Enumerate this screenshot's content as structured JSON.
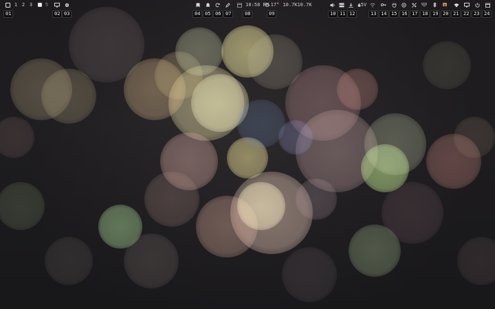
{
  "topbar": {
    "workspaces": [
      "1",
      "2",
      "3",
      "5"
    ],
    "clock": "10:58 PM",
    "weather": "17°",
    "net_down": "10.7K",
    "net_up": "10.7K",
    "volume_label": "5V"
  },
  "badges": [
    "01",
    "02",
    "03",
    "04",
    "05",
    "06",
    "07",
    "08",
    "09",
    "10",
    "11",
    "12",
    "13",
    "14",
    "15",
    "16",
    "17",
    "18",
    "19",
    "20",
    "21",
    "22",
    "23",
    "24"
  ],
  "colors": {
    "bar_text": "#d8d8d8",
    "badge_bg": "#0e0e0e",
    "badge_text": "#ececec"
  },
  "icons": {
    "01": "workspace-square-icon",
    "02": "monitor-icon",
    "03": "settings-gear-icon",
    "04": "bookmark-icon",
    "05": "bell-icon",
    "06": "refresh-icon",
    "07": "edit-icon",
    "08": "calendar-clock",
    "09": "weather-cloud-icon",
    "10": "volume-icon",
    "11": "storage-icon",
    "12": "download-icon",
    "13": "key-icon",
    "14": "plug-icon",
    "15": "cpu-icon",
    "16": "disk-icon",
    "17": "network-icon",
    "18": "bluetooth-icon",
    "19": "battery-icon",
    "20": "wifi-icon",
    "21": "screen-icon",
    "22": "power-icon",
    "23": "calendar-icon",
    "24": "more-icon"
  }
}
